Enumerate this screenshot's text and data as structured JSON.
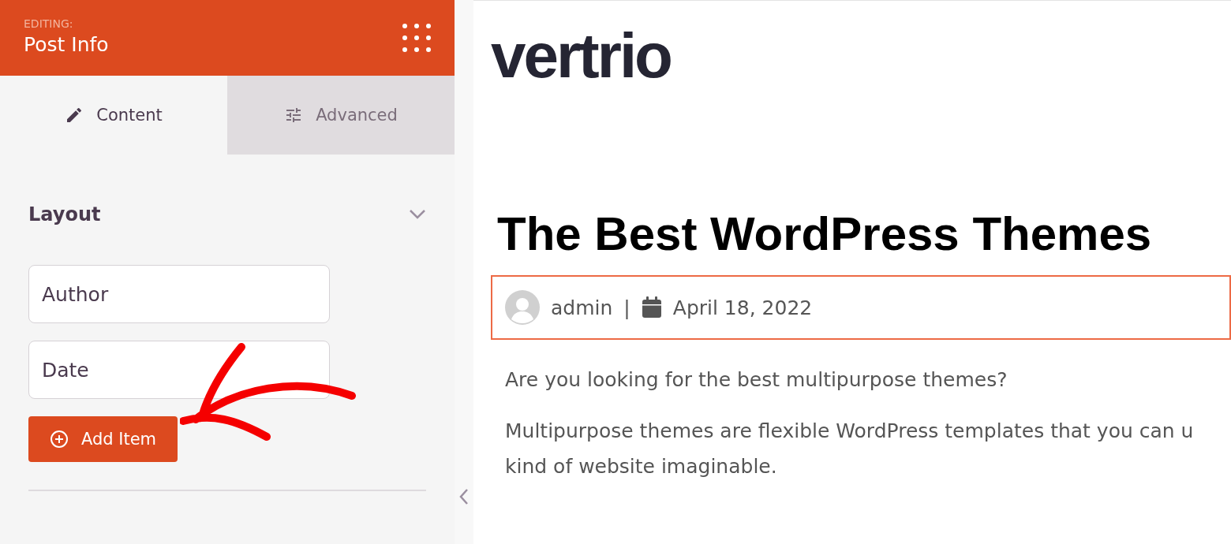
{
  "editor": {
    "label": "EDITING:",
    "title": "Post Info"
  },
  "tabs": [
    {
      "label": "Content",
      "kind": "pencil",
      "selected": true
    },
    {
      "label": "Advanced",
      "kind": "sliders",
      "selected": false
    }
  ],
  "section": {
    "title": "Layout",
    "expanded": true
  },
  "items": [
    "Author",
    "Date"
  ],
  "add_button": "Add Item",
  "page": {
    "logo": "vertrio",
    "title": "The Best WordPress Themes",
    "meta": {
      "author": "admin",
      "separator": "|",
      "date": "April 18, 2022",
      "selected": true
    },
    "paragraphs": [
      "Are you looking for the best multipurpose themes?",
      "Multipurpose themes are flexible WordPress templates that you can u",
      "kind of website imaginable."
    ]
  }
}
